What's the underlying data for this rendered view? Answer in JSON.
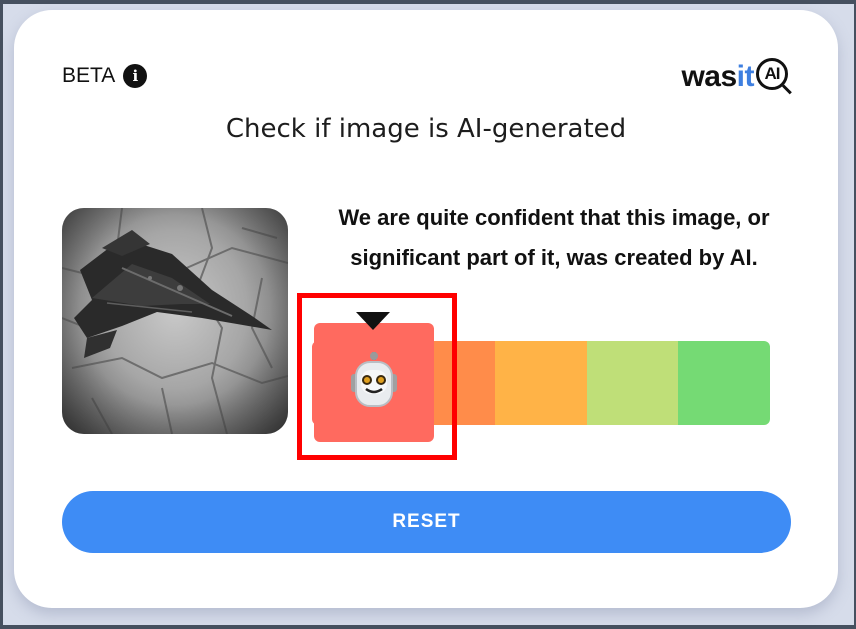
{
  "header": {
    "beta_label": "BETA",
    "info_icon": "info-icon",
    "logo_prefix": "was",
    "logo_accent": "it",
    "logo_ai": "AI"
  },
  "title": "Check if image is AI-generated",
  "result": {
    "message_line1": "We are quite confident that this image, or",
    "message_line2": "significant part of it, was created by AI.",
    "robot_icon": "🤖"
  },
  "scale": {
    "segments": [
      "#ff6a5f",
      "#ff8c4a",
      "#ffb347",
      "#bfdf78",
      "#75da74"
    ],
    "active_index": 0
  },
  "reset_label": "RESET",
  "colors": {
    "accent": "#3e8cf5",
    "logo_accent": "#3e7fe0",
    "highlight": "#ff0000"
  }
}
